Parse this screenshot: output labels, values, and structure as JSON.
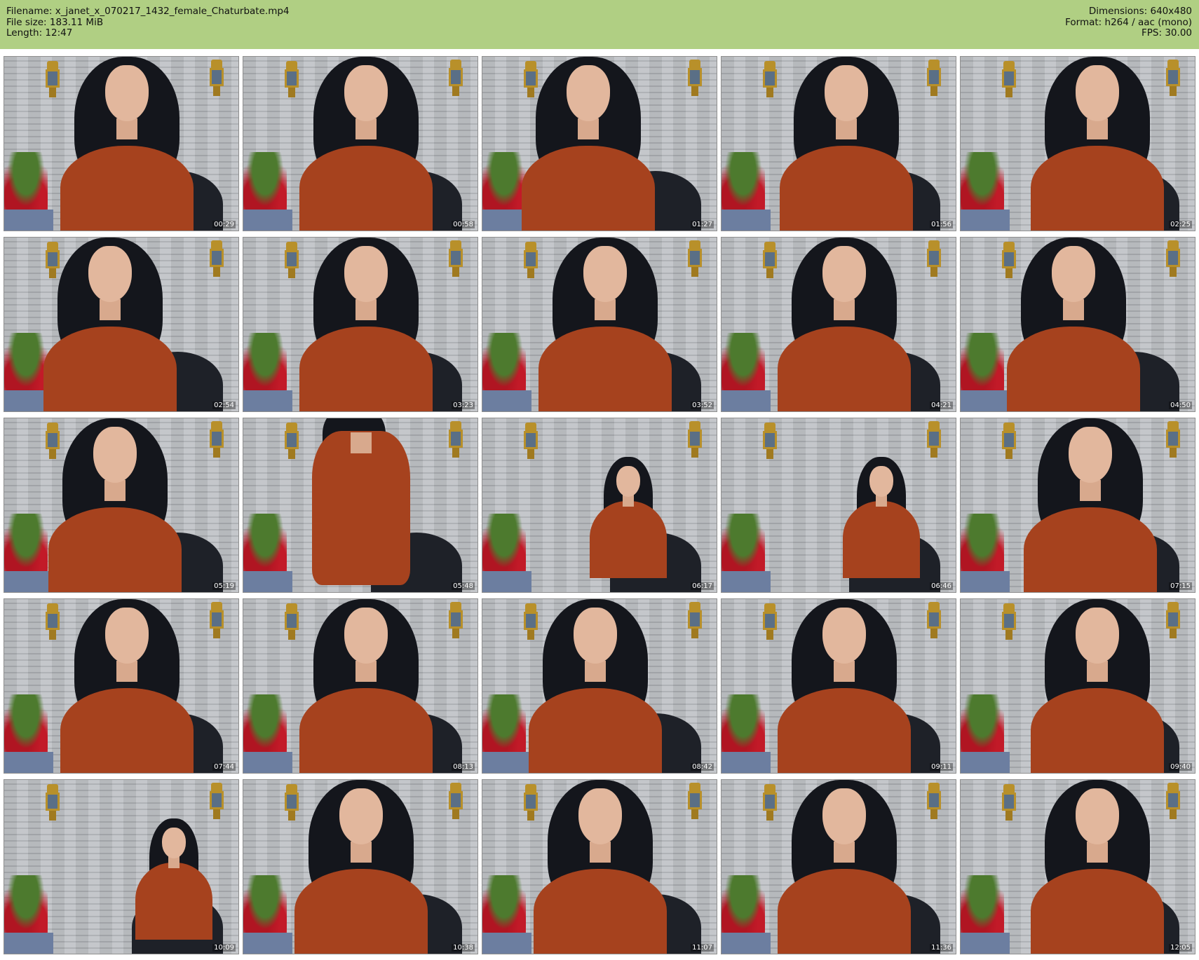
{
  "header": {
    "filename": "Filename: x_janet_x_070217_1432_female_Chaturbate.mp4",
    "filesize": "File size: 183.11 MiB",
    "length": "Length: 12:47",
    "dimensions": "Dimensions: 640x480",
    "format": "Format: h264 / aac (mono)",
    "fps": "FPS: 30.00"
  },
  "thumbnails": [
    {
      "time": "00:29",
      "pose": "sit",
      "x": 0.52
    },
    {
      "time": "00:58",
      "pose": "sit",
      "x": 0.52
    },
    {
      "time": "01:27",
      "pose": "sit",
      "x": 0.45
    },
    {
      "time": "01:56",
      "pose": "sit",
      "x": 0.53
    },
    {
      "time": "02:25",
      "pose": "sit",
      "x": 0.58
    },
    {
      "time": "02:54",
      "pose": "sit",
      "x": 0.45
    },
    {
      "time": "03:23",
      "pose": "sit",
      "x": 0.52
    },
    {
      "time": "03:52",
      "pose": "sit",
      "x": 0.52
    },
    {
      "time": "04:21",
      "pose": "sit",
      "x": 0.52
    },
    {
      "time": "04:50",
      "pose": "sit",
      "x": 0.48
    },
    {
      "time": "05:19",
      "pose": "sit",
      "x": 0.47
    },
    {
      "time": "05:48",
      "pose": "stand",
      "x": 0.5
    },
    {
      "time": "06:17",
      "pose": "recline",
      "x": 0.62
    },
    {
      "time": "06:46",
      "pose": "recline",
      "x": 0.68
    },
    {
      "time": "07:15",
      "pose": "sit",
      "x": 0.55
    },
    {
      "time": "07:44",
      "pose": "sit",
      "x": 0.52
    },
    {
      "time": "08:13",
      "pose": "sit",
      "x": 0.52
    },
    {
      "time": "08:42",
      "pose": "sit",
      "x": 0.48
    },
    {
      "time": "09:11",
      "pose": "sit",
      "x": 0.52
    },
    {
      "time": "09:40",
      "pose": "sit",
      "x": 0.58
    },
    {
      "time": "10:09",
      "pose": "recline",
      "x": 0.72
    },
    {
      "time": "10:38",
      "pose": "sit",
      "x": 0.5
    },
    {
      "time": "11:07",
      "pose": "sit",
      "x": 0.5
    },
    {
      "time": "11:36",
      "pose": "sit",
      "x": 0.52
    },
    {
      "time": "12:05",
      "pose": "sit",
      "x": 0.58
    }
  ]
}
